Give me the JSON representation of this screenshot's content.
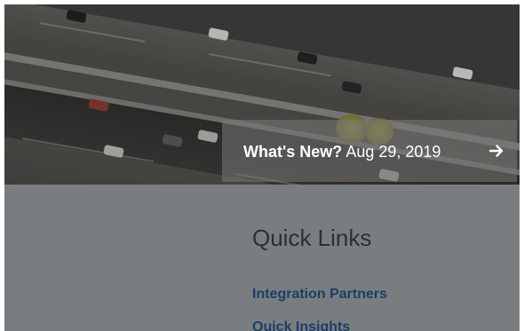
{
  "news": {
    "label": "What's New?",
    "date": "Aug 29, 2019",
    "arrow_icon": "arrow-right-icon"
  },
  "quick_links": {
    "heading": "Quick Links",
    "items": [
      {
        "label": "Integration Partners"
      },
      {
        "label": "Quick Insights"
      }
    ]
  },
  "colors": {
    "panel_background": "#7a7d80",
    "link": "#1a3f66",
    "heading": "#2d2f31",
    "banner_text": "#ffffff"
  }
}
